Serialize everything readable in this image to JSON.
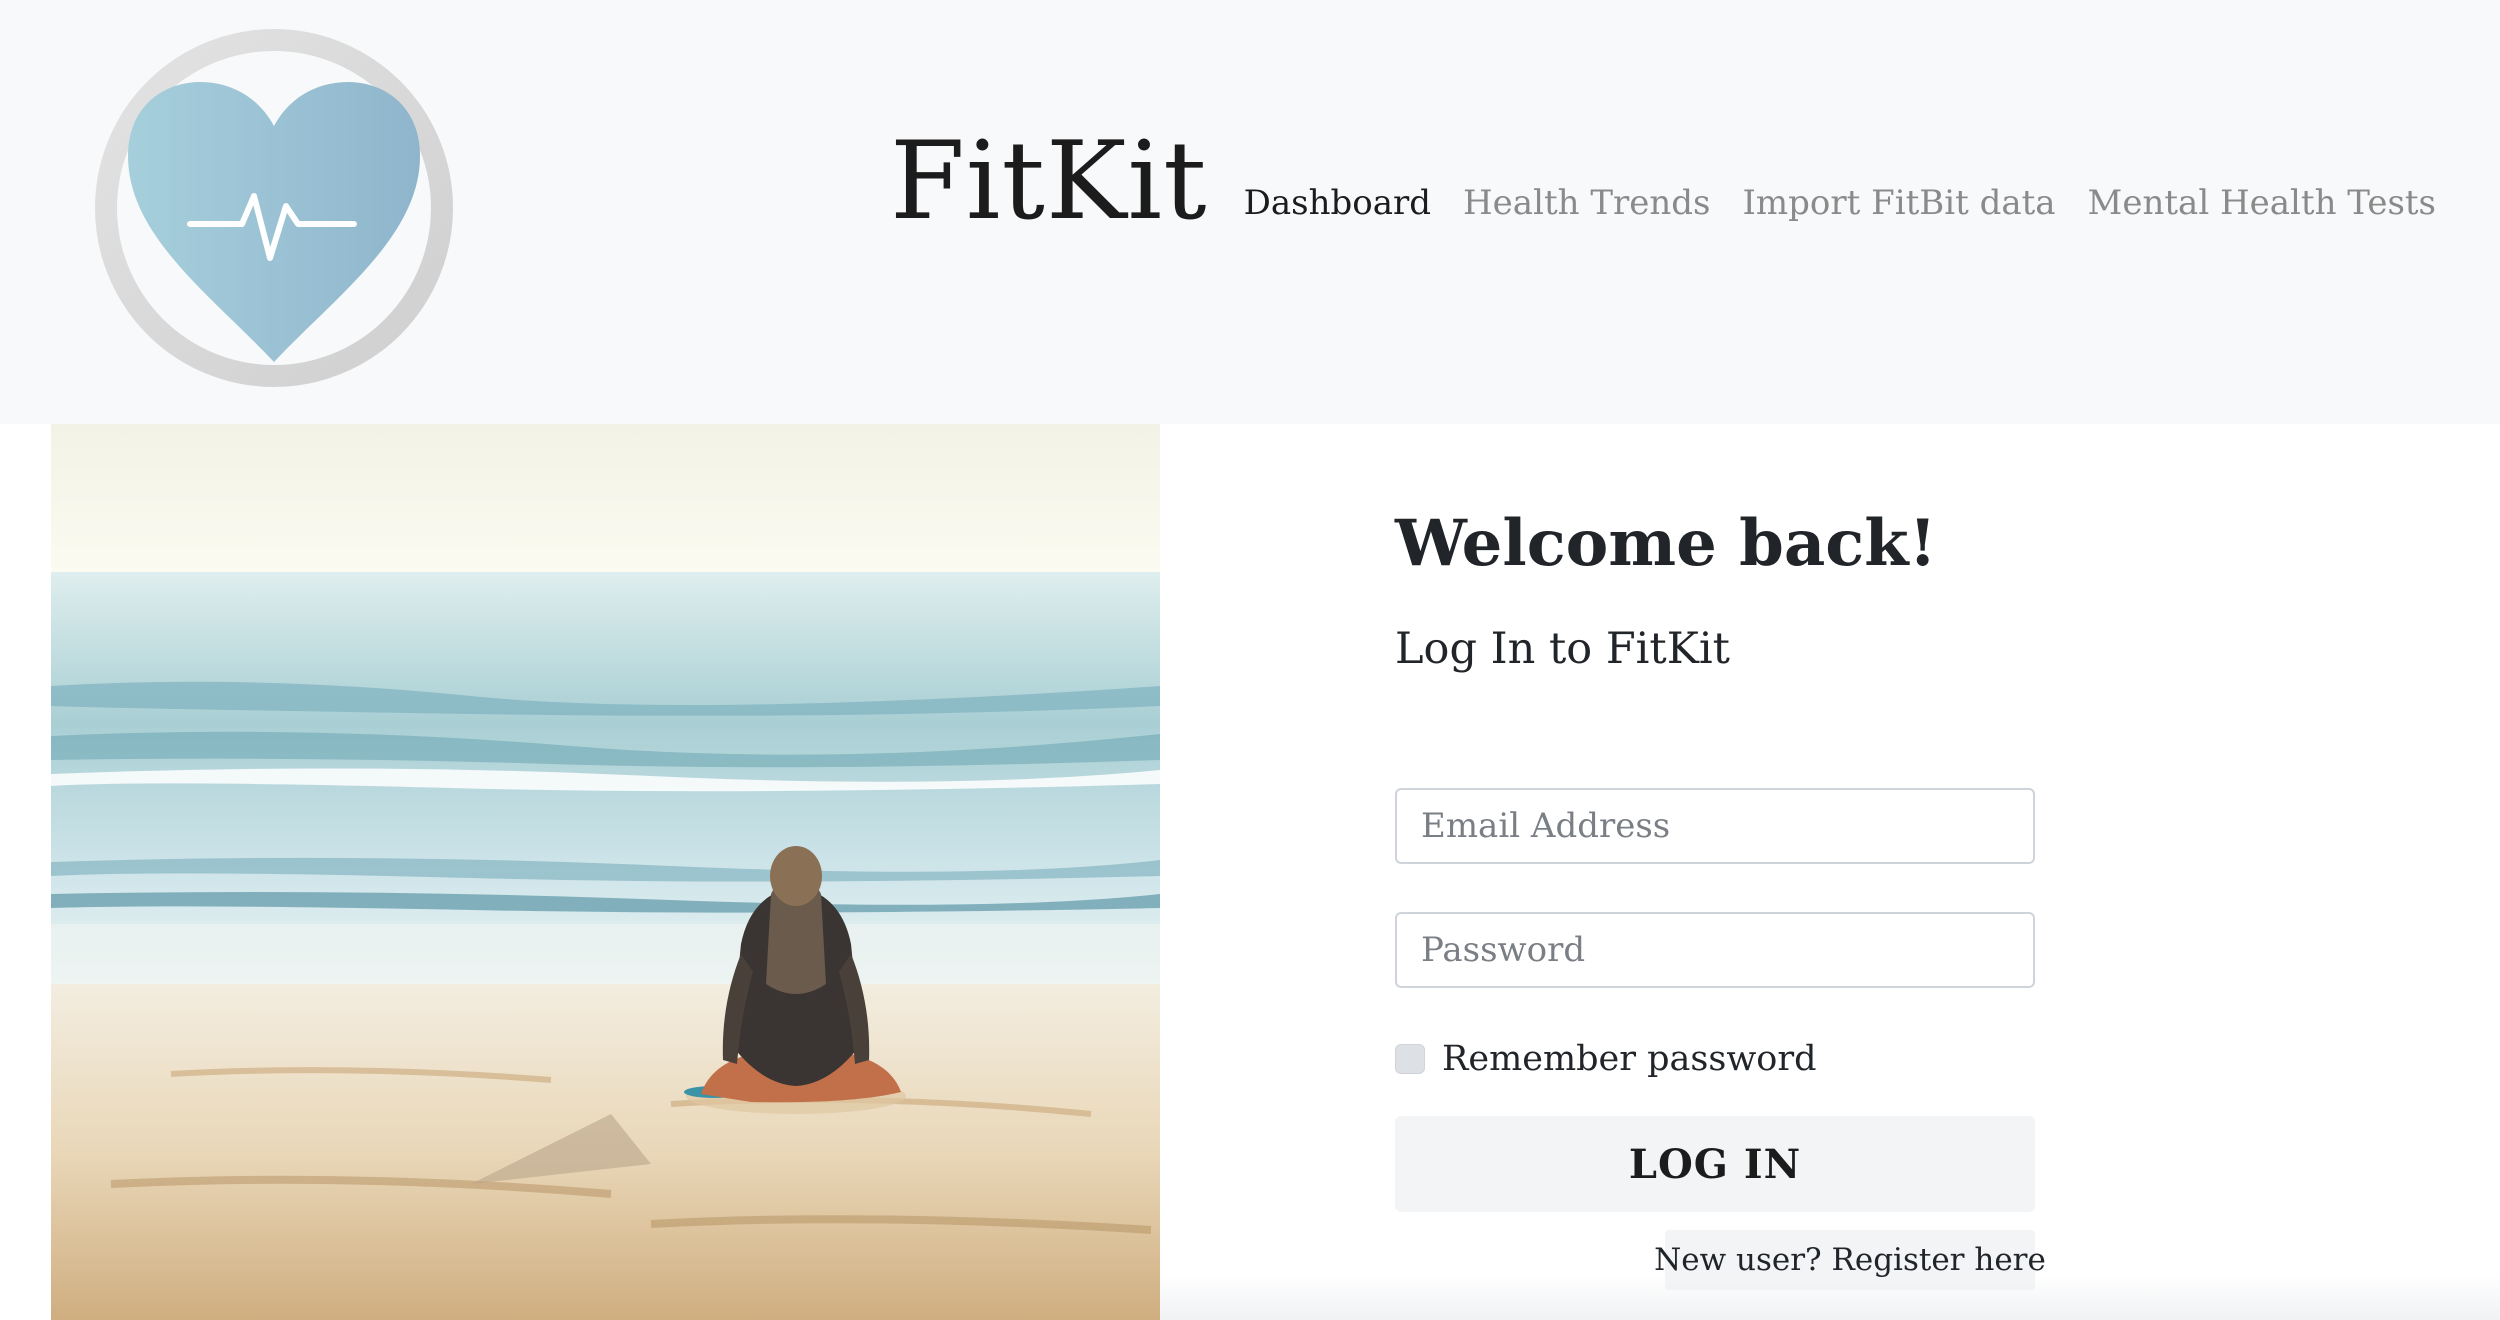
{
  "header": {
    "brand": "FitKit",
    "nav": [
      {
        "label": "Dashboard",
        "active": true
      },
      {
        "label": "Health Trends",
        "active": false
      },
      {
        "label": "Import FitBit data",
        "active": false
      },
      {
        "label": "Mental Health Tests",
        "active": false
      }
    ]
  },
  "logo": {
    "icon": "heart-pulse-icon",
    "color": "#9cc3d6"
  },
  "hero": {
    "image": "beach-meditation-photo"
  },
  "login": {
    "welcome": "Welcome back!",
    "subtitle": "Log In to FitKit",
    "email_placeholder": "Email Address",
    "password_placeholder": "Password",
    "remember_label": "Remember password",
    "remember_checked": false,
    "button_label": "LOG IN",
    "register_label": "New user? Register here"
  }
}
